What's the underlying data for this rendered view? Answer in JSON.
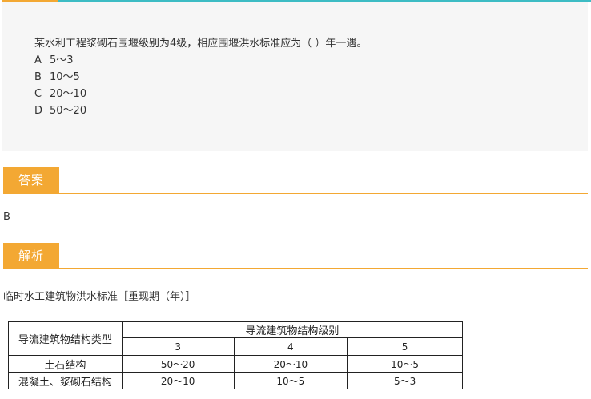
{
  "question": {
    "stem": "某水利工程浆砌石围堰级别为4级，相应围堰洪水标准应为（   ）年一遇。",
    "options": [
      {
        "letter": "A",
        "text": "5～3"
      },
      {
        "letter": "B",
        "text": "10～5"
      },
      {
        "letter": "C",
        "text": "20～10"
      },
      {
        "letter": "D",
        "text": "50～20"
      }
    ]
  },
  "answer": {
    "tab_label": "答案",
    "value": "B"
  },
  "analysis": {
    "tab_label": "解析",
    "text": "临时水工建筑物洪水标准［重现期（年）］"
  },
  "table": {
    "col_header_type": "导流建筑物结构类型",
    "col_header_level": "导流建筑物结构级别",
    "levels": [
      "3",
      "4",
      "5"
    ],
    "rows": [
      {
        "type": "土石结构",
        "values": [
          "50～20",
          "20～10",
          "10～5"
        ]
      },
      {
        "type": "混凝土、浆砌石结构",
        "values": [
          "20～10",
          "10～5",
          "5～3"
        ]
      }
    ]
  },
  "colors": {
    "accent_orange": "#f3a833",
    "accent_teal": "#3dbcc4"
  }
}
